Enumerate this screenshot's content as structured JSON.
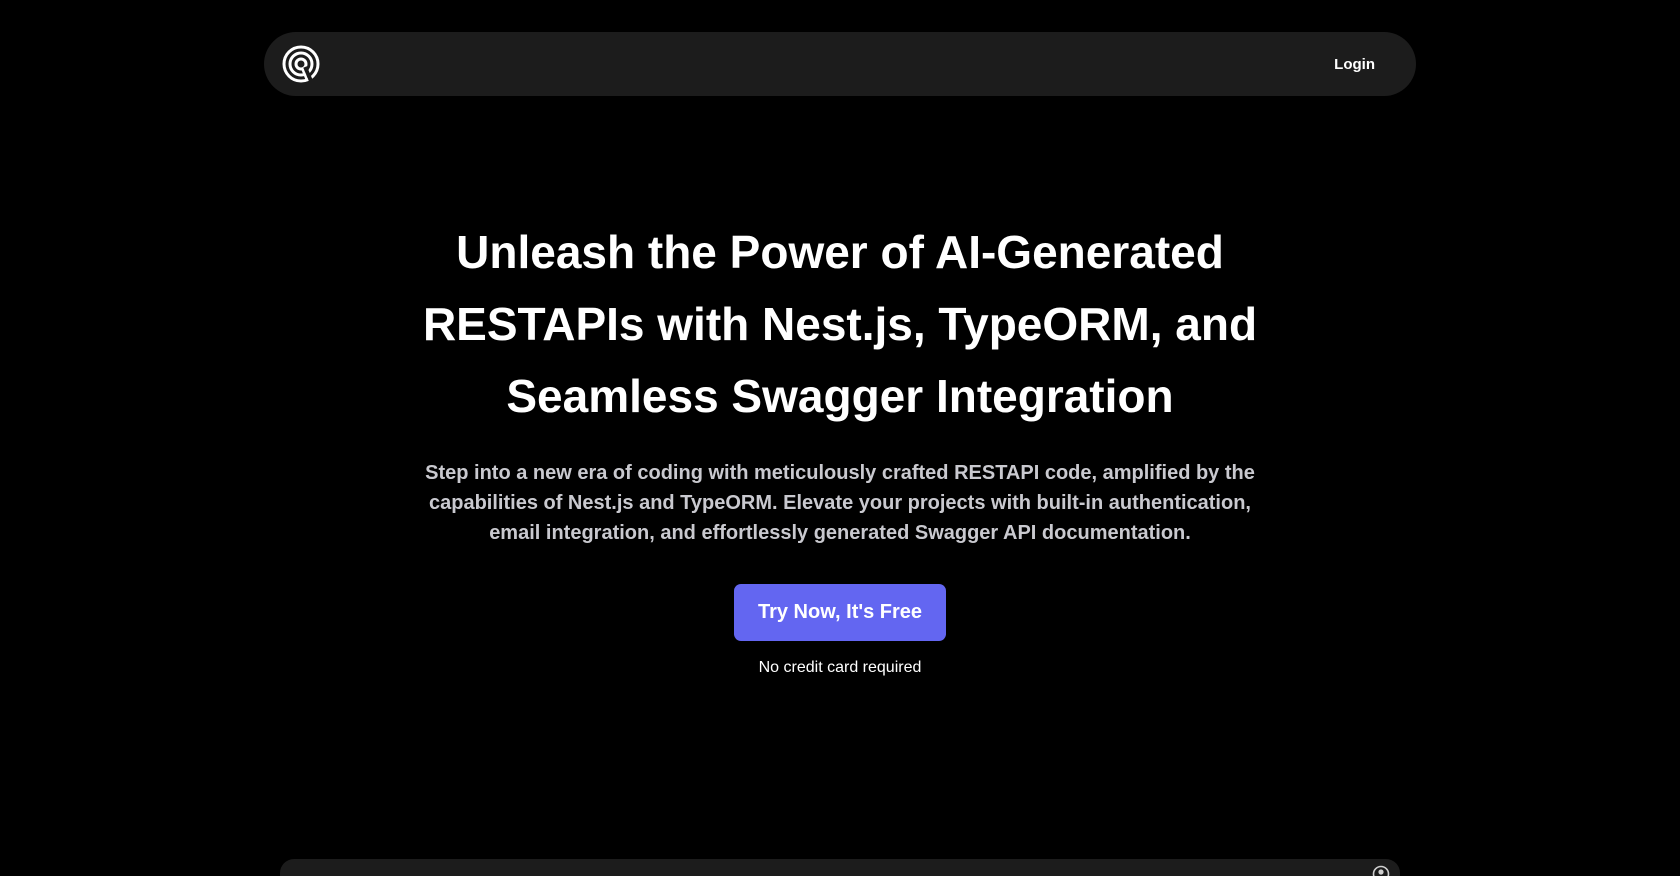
{
  "navbar": {
    "logo_icon": "spiral-logo-icon",
    "login_label": "Login"
  },
  "hero": {
    "title": "Unleash the Power of AI-Generated RESTAPIs with Nest.js, TypeORM, and Seamless Swagger Integration",
    "subtitle": "Step into a new era of coding with meticulously crafted RESTAPI code, amplified by the capabilities of Nest.js and TypeORM. Elevate your projects with built-in authentication, email integration, and effortlessly generated Swagger API documentation.",
    "cta_label": "Try Now, It's Free",
    "cta_note": "No credit card required"
  },
  "bottom_panel": {
    "icon": "user-circle-icon"
  },
  "colors": {
    "background": "#000000",
    "navbar": "#1c1c1c",
    "accent": "#6366f1",
    "subtitle_text": "#c9c9cf"
  }
}
